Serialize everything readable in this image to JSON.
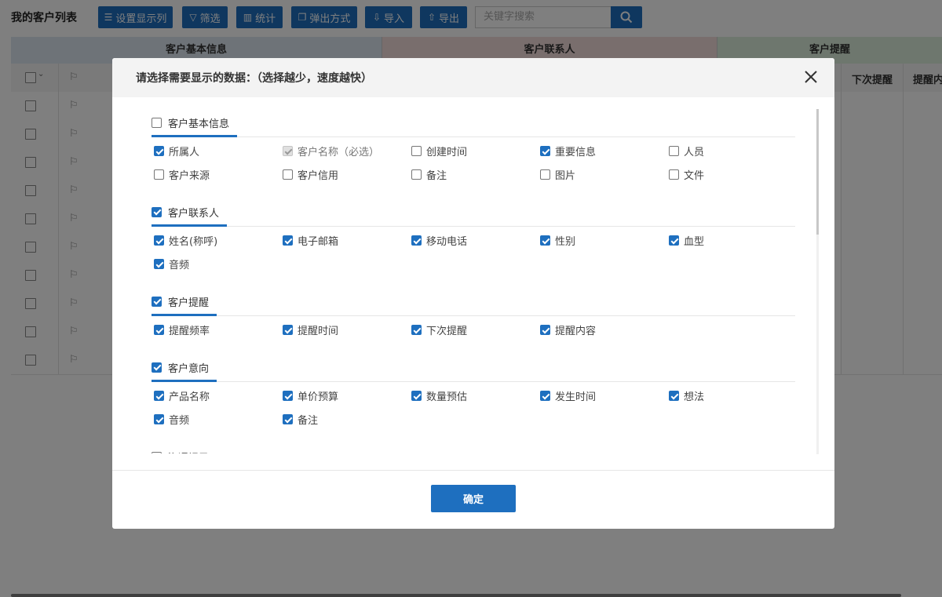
{
  "page": {
    "title": "我的客户列表"
  },
  "toolbar": {
    "columns_label": "设置显示列",
    "filter_label": "筛选",
    "stats_label": "统计",
    "popup_label": "弹出方式",
    "import_label": "导入",
    "export_label": "导出"
  },
  "search": {
    "placeholder": "关键字搜索"
  },
  "table": {
    "groups": [
      "客户基本信息",
      "客户联系人",
      "客户提醒"
    ],
    "visible_headers": [
      "下次提醒",
      "提醒内"
    ],
    "row_count": 10
  },
  "modal": {
    "title": "请选择需要显示的数据：（选择越少，速度越快）",
    "confirm_label": "确定",
    "sections": [
      {
        "label": "客户基本信息",
        "checked": false,
        "options": [
          {
            "label": "所属人",
            "checked": true
          },
          {
            "label": "客户名称（必选）",
            "checked": true,
            "disabled": true
          },
          {
            "label": "创建时间",
            "checked": false
          },
          {
            "label": "重要信息",
            "checked": true
          },
          {
            "label": "人员",
            "checked": false
          },
          {
            "label": "客户来源",
            "checked": false
          },
          {
            "label": "客户信用",
            "checked": false
          },
          {
            "label": "备注",
            "checked": false
          },
          {
            "label": "图片",
            "checked": false
          },
          {
            "label": "文件",
            "checked": false
          }
        ]
      },
      {
        "label": "客户联系人",
        "checked": true,
        "options": [
          {
            "label": "姓名(称呼)",
            "checked": true
          },
          {
            "label": "电子邮箱",
            "checked": true
          },
          {
            "label": "移动电话",
            "checked": true
          },
          {
            "label": "性别",
            "checked": true
          },
          {
            "label": "血型",
            "checked": true
          },
          {
            "label": "音频",
            "checked": true
          }
        ]
      },
      {
        "label": "客户提醒",
        "checked": true,
        "options": [
          {
            "label": "提醒频率",
            "checked": true
          },
          {
            "label": "提醒时间",
            "checked": true
          },
          {
            "label": "下次提醒",
            "checked": true
          },
          {
            "label": "提醒内容",
            "checked": true
          }
        ]
      },
      {
        "label": "客户意向",
        "checked": true,
        "options": [
          {
            "label": "产品名称",
            "checked": true
          },
          {
            "label": "单价预算",
            "checked": true
          },
          {
            "label": "数量预估",
            "checked": true
          },
          {
            "label": "发生时间",
            "checked": true
          },
          {
            "label": "想法",
            "checked": true
          },
          {
            "label": "音频",
            "checked": true
          },
          {
            "label": "备注",
            "checked": true
          }
        ]
      },
      {
        "label": "沟通记录",
        "checked": false,
        "options": []
      }
    ]
  },
  "colors": {
    "primary": "#1e6fbf",
    "group_basic": "#dce6f0",
    "group_contact": "#f2dcdb",
    "group_reminder": "#dcefdc"
  }
}
